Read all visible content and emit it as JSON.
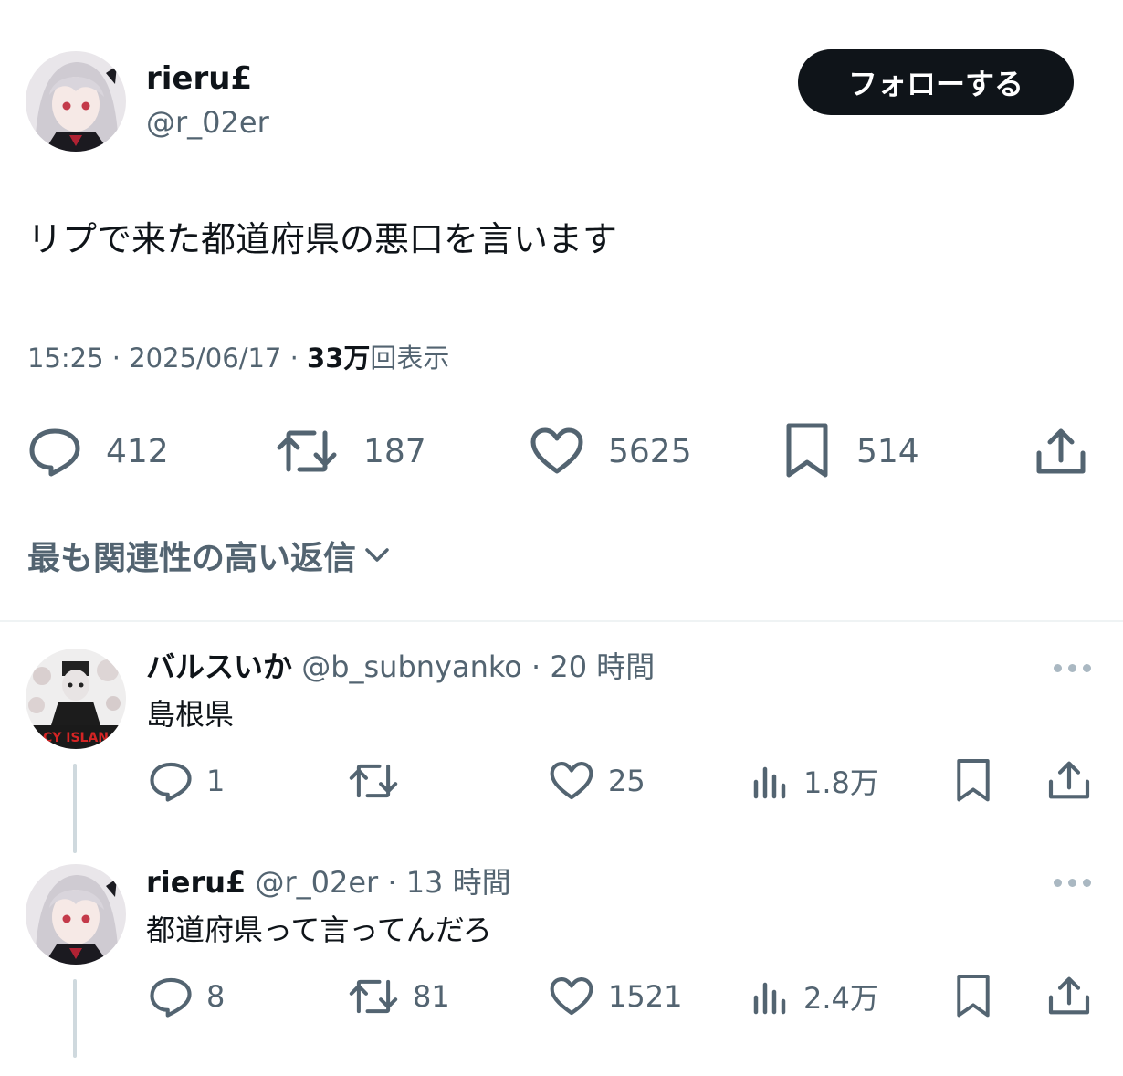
{
  "tweet": {
    "author_name": "rieru£",
    "author_handle": "@r_02er",
    "follow_label": "フォローする",
    "text": "リプで来た都道府県の悪口を言います",
    "time": "15:25",
    "date": "2025/06/17",
    "views_count": "33",
    "views_unit": "万",
    "views_label": "回表示",
    "actions": {
      "replies": "412",
      "retweets": "187",
      "likes": "5625",
      "bookmarks": "514"
    }
  },
  "sort_label": "最も関連性の高い返信",
  "replies": [
    {
      "name": "バルスいか",
      "handle": "@b_subnyanko",
      "time": "20 時間",
      "text": "島根県",
      "replies": "1",
      "retweets": "",
      "likes": "25",
      "views": "1.8万",
      "avatar_caption": "CY ISLAN"
    },
    {
      "name": "rieru£",
      "handle": "@r_02er",
      "time": "13 時間",
      "text": "都道府県って言ってんだろ",
      "replies": "8",
      "retweets": "81",
      "likes": "1521",
      "views": "2.4万"
    }
  ],
  "icons": [
    "reply-icon",
    "retweet-icon",
    "like-icon",
    "bookmark-icon",
    "share-icon",
    "views-icon",
    "more-icon",
    "chevron-down-icon"
  ],
  "colors": {
    "text": "#0f1419",
    "secondary": "#536471",
    "button": "#0f1419",
    "divider": "#eff3f4",
    "thread": "#cfd9de"
  }
}
